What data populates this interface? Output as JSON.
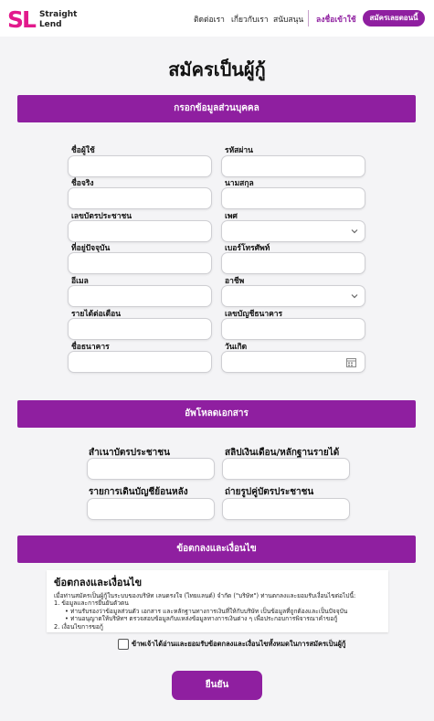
{
  "header": {
    "logo_mark": "SL",
    "logo_line1": "Straight",
    "logo_line2": "Lend",
    "nav": [
      "ติดต่อเรา",
      "เกี่ยวกับเรา",
      "สนับสนุน"
    ],
    "login": "ลงชื่อเข้าใช้",
    "cta": "สมัครเลยตอนนี้"
  },
  "page_title": "สมัครเป็นผู้กู้",
  "personal": {
    "section_title": "กรอกข้อมูลส่วนบุคคล",
    "fields": [
      {
        "label": "ชื่อผู้ใช้",
        "value": ""
      },
      {
        "label": "รหัสผ่าน",
        "value": ""
      },
      {
        "label": "ชื่อจริง",
        "value": ""
      },
      {
        "label": "นามสกุล",
        "value": ""
      },
      {
        "label": "เลขบัตรประชาชน",
        "value": ""
      },
      {
        "label": "เพศ",
        "value": ""
      },
      {
        "label": "ที่อยู่ปัจจุบัน",
        "value": ""
      },
      {
        "label": "เบอร์โทรศัพท์",
        "value": ""
      },
      {
        "label": "อีเมล",
        "value": ""
      },
      {
        "label": "อาชีพ",
        "value": ""
      },
      {
        "label": "รายได้ต่อเดือน",
        "value": ""
      },
      {
        "label": "เลขบัญชีธนาคาร",
        "value": ""
      },
      {
        "label": "ชื่อธนาคาร",
        "value": ""
      },
      {
        "label": "วันเกิด",
        "value": ""
      }
    ]
  },
  "upload": {
    "section_title": "อัพโหลดเอกสาร",
    "fields": [
      {
        "label": "สำเนาบัตรประชาชน"
      },
      {
        "label": "สลิปเงินเดือน/หลักฐานรายได้"
      },
      {
        "label": "รายการเดินบัญชีย้อนหลัง"
      },
      {
        "label": "ถ่ายรูปคู่บัตรประชาชน"
      }
    ]
  },
  "terms": {
    "section_title": "ข้อตกลงและเงื่อนไข",
    "box_title": "ข้อตกลงและเงื่อนไข",
    "intro": "เมื่อท่านสมัครเป็นผู้กู้ในระบบของบริษัท เลนดรงใจ (ไทยแลนด์) จำกัด (\"บริษัท\") ท่านตกลงและยอมรับเงื่อนไขต่อไปนี้:",
    "item1": "1. ข้อมูลและการยืนยันตัวตน",
    "bullet1": "ท่านรับรองว่าข้อมูลส่วนตัว เอกสาร และหลักฐานทางการเงินที่ให้กับบริษัท เป็นข้อมูลที่ถูกต้องและเป็นปัจจุบัน",
    "bullet2": "ท่านอนุญาตให้บริษัทฯ ตรวจสอบข้อมูลกับแหล่งข้อมูลทางการเงินต่าง ๆ เพื่อประกอบการพิจารณาคำขอกู้",
    "item2": "2. เงื่อนไขการขอกู้",
    "agree": "ข้าพเจ้าได้อ่านและยอมรับข้อตกลงและเงื่อนไขทั้งหมดในการสมัครเป็นผู้กู้",
    "agreed": false
  },
  "submit": "ยืนยัน",
  "colors": {
    "brand": "#8f1fa0",
    "logo": "#e21a8c"
  }
}
